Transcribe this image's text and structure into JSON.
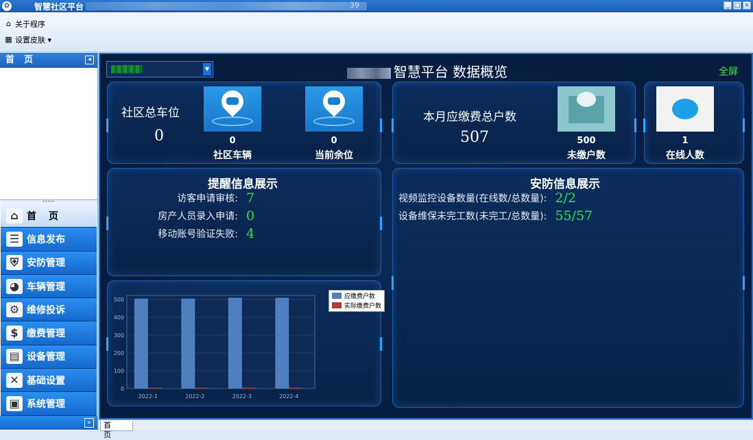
{
  "window": {
    "title": "智慧社区平台",
    "title_tail": "39",
    "controls": [
      "_",
      "□",
      "×"
    ]
  },
  "menu": {
    "about": "关于程序",
    "skin": "设置皮肤 ▾"
  },
  "sidebar": {
    "header": "首页",
    "collapse_glyph": "◂",
    "splitter": "•••••",
    "expand_glyph": "»",
    "items": [
      {
        "label": "首页",
        "icon": "home-icon",
        "glyph": "⌂",
        "active": true
      },
      {
        "label": "信息发布",
        "icon": "list-icon",
        "glyph": "☰",
        "active": false
      },
      {
        "label": "安防管理",
        "icon": "basket-icon",
        "glyph": "⛨",
        "active": false
      },
      {
        "label": "车辆管理",
        "icon": "car-icon",
        "glyph": "◕",
        "active": false
      },
      {
        "label": "维修投诉",
        "icon": "gears-icon",
        "glyph": "⚙",
        "active": false
      },
      {
        "label": "缴费管理",
        "icon": "coin-icon",
        "glyph": "$",
        "active": false
      },
      {
        "label": "设备管理",
        "icon": "tablet-icon",
        "glyph": "▤",
        "active": false
      },
      {
        "label": "基础设置",
        "icon": "tools-icon",
        "glyph": "✕",
        "active": false
      },
      {
        "label": "系统管理",
        "icon": "monitor-icon",
        "glyph": "▣",
        "active": false
      }
    ]
  },
  "dashboard": {
    "title": "智慧平台 数据概览",
    "fullscreen": "全屏",
    "parking": {
      "total_label": "社区总车位",
      "total_value": "0",
      "vehicles_value": "0",
      "vehicles_label": "社区车辆",
      "remaining_value": "0",
      "remaining_label": "当前余位"
    },
    "fees": {
      "label": "本月应缴费总户数",
      "value": "507",
      "unpaid_value": "500",
      "unpaid_label": "未缴户数"
    },
    "online": {
      "value": "1",
      "label": "在线人数"
    },
    "reminders": {
      "title": "提醒信息展示",
      "rows": [
        {
          "label": "访客申请审核:",
          "value": "7"
        },
        {
          "label": "房产人员录入申请:",
          "value": "0"
        },
        {
          "label": "移动账号验证失败:",
          "value": "4"
        }
      ]
    },
    "security": {
      "title": "安防信息展示",
      "rows": [
        {
          "label": "视频监控设备数量(在线数/总数量):",
          "value": "2/2"
        },
        {
          "label": "设备维保未完工数(未完工/总数量):",
          "value": "55/57"
        }
      ]
    }
  },
  "chart_data": {
    "type": "bar",
    "categories": [
      "2022-1",
      "2022-2",
      "2022-3",
      "2022-4"
    ],
    "series": [
      {
        "name": "应缴费户数",
        "values": [
          505,
          505,
          510,
          510
        ],
        "color": "#4f7fbf"
      },
      {
        "name": "实际缴费户数",
        "values": [
          5,
          5,
          5,
          5
        ],
        "color": "#b23a3a"
      }
    ],
    "ylim": [
      0,
      500
    ],
    "yticks": [
      "0",
      "100",
      "200",
      "300",
      "400",
      "500"
    ],
    "grid": true,
    "legend": "top-right"
  },
  "bottom_tabs": [
    "首页"
  ]
}
